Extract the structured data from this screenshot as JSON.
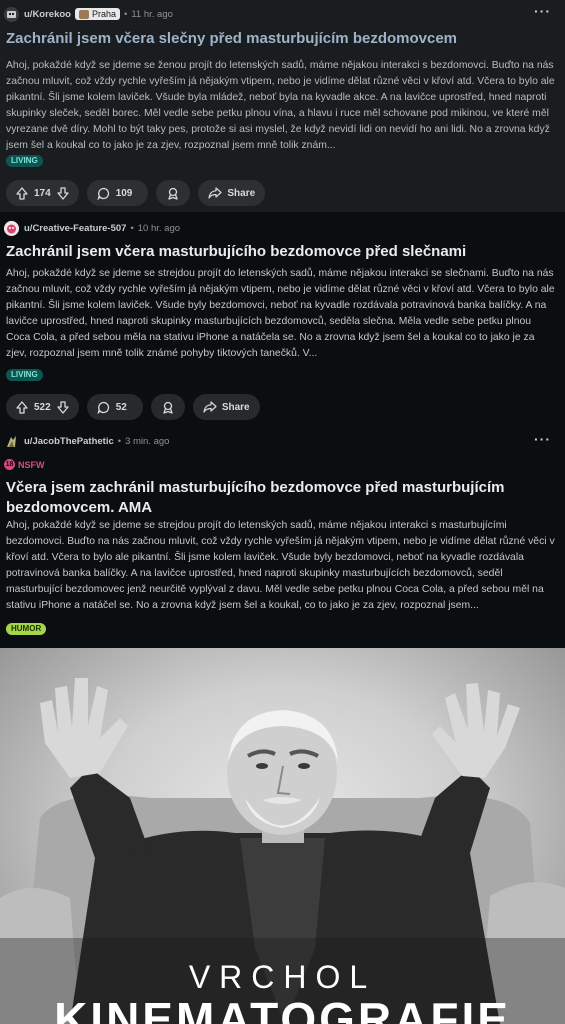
{
  "posts": [
    {
      "user": "u/Korekoo",
      "flair": "Praha",
      "time": "11 hr. ago",
      "title": "Zachránil jsem včera slečny před masturbujícím bezdomovcem",
      "body": "Ahoj, pokaždé když se jdeme se ženou projít do letenských sadů, máme nějakou interakci s bezdomovci. Buďto na nás začnou mluvit, což vždy rychle vyřeším já nějakým vtipem, nebo je vidíme dělat různé věci v křoví atd. Včera to bylo ale pikantní. Šli jsme kolem laviček. Všude byla mládež, neboť byla na kyvadle akce. A na lavičce uprostřed, hned naproti skupinky sleček, seděl borec. Měl vedle sebe petku plnou vína, a hlavu i ruce měl schovane pod mikinou, ve které měl vyrezane dvě díry. Mohl to být taky pes, protože si asi myslel, že když nevidí lidi on nevidí ho ani lidi. No a zrovna když jsem šel a koukal co to jako je za zjev, rozpoznal jsem mně tolik znám...",
      "tag": "LIVING",
      "votes": "174",
      "comments": "109",
      "share": "Share"
    },
    {
      "user": "u/Creative-Feature-507",
      "time": "10 hr. ago",
      "title": "Zachránil jsem včera masturbujícího bezdomovce před slečnami",
      "body": "Ahoj, pokaždé když se jdeme se strejdou projít do letenských sadů, máme nějakou interakci se slečnami. Buďto na nás začnou mluvit, což vždy rychle vyřeším já nějakým vtipem, nebo je vidíme dělat různé věci v křoví atd. Včera to bylo ale pikantní. Šli jsme kolem laviček. Všude byly bezdomovci, neboť na kyvadle rozdávala potravinová banka balíčky. A na lavičce uprostřed, hned naproti skupinky masturbujících bezdomovců, seděla slečna. Měla vedle sebe petku plnou Coca Cola, a před sebou měla na stativu iPhone a natáčela se. No a zrovna když jsem šel a koukal co to jako je za zjev, rozpoznal jsem mně tolik známé pohyby tiktových tanečků. V...",
      "tag": "LIVING",
      "votes": "522",
      "comments": "52",
      "share": "Share"
    },
    {
      "user": "u/JacobThePathetic",
      "time": "3 min. ago",
      "nsfw": "NSFW",
      "title": "Včera jsem zachránil masturbujícího bezdomovce před masturbujícím bezdomovcem. AMA",
      "body": "Ahoj, pokaždé když se jdeme se strejdou projít do letenských sadů, máme nějakou interakci s masturbujícími bezdomovci. Buďto na nás začnou mluvit, což vždy rychle vyřeším já nějakým vtipem, nebo je vidíme dělat různé věci v křoví atd. Včera to bylo ale pikantní. Šli jsme kolem laviček. Všude byly bezdomovci, neboť na kyvadle rozdávala potravinová banka balíčky. A na lavičce uprostřed, hned naproti skupinky masturbujících bezdomovců, seděl masturbující bezdomovec jenž neurčitě vyplýval z davu. Měl vedle sebe petku plnou Coca Cola, a před sebou měl na stativu iPhone a natáčel se. No a zrovna když jsem šel a koukal, co to jako je za zjev, rozpoznal jsem...",
      "tag": "HUMOR"
    }
  ],
  "meme": {
    "line1": "VRCHOL",
    "line2": "KINEMATOGRAFIE"
  },
  "colors": {
    "background": "#0e1113",
    "post_highlight": "#1a1d20",
    "tag_living": "#0e5552",
    "tag_humor": "#a5d64a",
    "nsfw": "#d94a7a"
  }
}
